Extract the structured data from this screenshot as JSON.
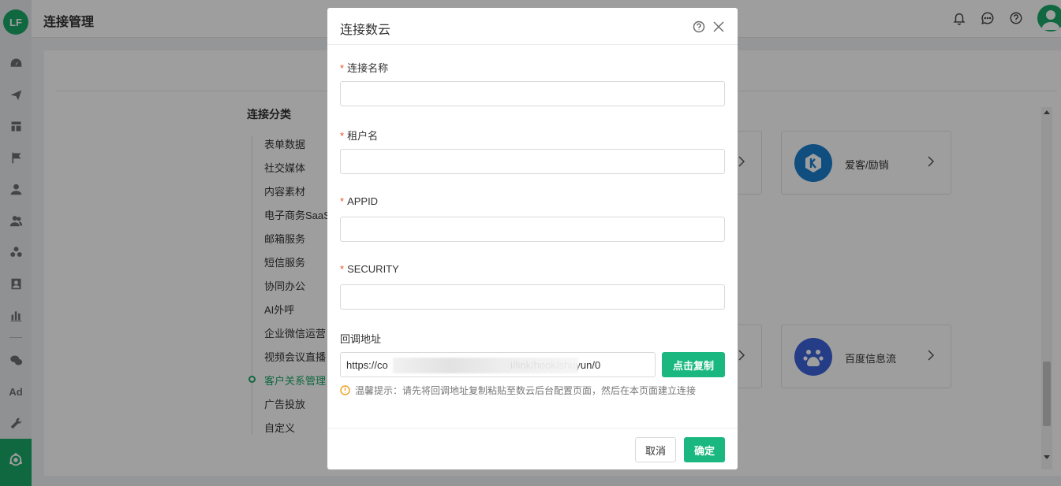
{
  "app": {
    "logo_text": "LF",
    "page_title": "连接管理"
  },
  "sidebar": {
    "items": [
      {
        "icon": "dashboard-icon"
      },
      {
        "icon": "send-icon"
      },
      {
        "icon": "layout-icon"
      },
      {
        "icon": "flag-icon"
      },
      {
        "icon": "user-icon"
      },
      {
        "icon": "users-icon"
      },
      {
        "icon": "groups-icon"
      },
      {
        "icon": "contact-card-icon"
      },
      {
        "icon": "bar-chart-icon"
      },
      {
        "icon": "wechat-icon"
      },
      {
        "icon": "ad-icon",
        "text": "Ad"
      },
      {
        "icon": "wrench-icon"
      },
      {
        "icon": "connection-icon",
        "active": true
      }
    ]
  },
  "header_icons": [
    "bell-icon",
    "message-icon",
    "help-icon",
    "avatar"
  ],
  "categories": {
    "title": "连接分类",
    "items": [
      {
        "label": "表单数据"
      },
      {
        "label": "社交媒体"
      },
      {
        "label": "内容素材"
      },
      {
        "label": "电子商务SaaS"
      },
      {
        "label": "邮箱服务"
      },
      {
        "label": "短信服务"
      },
      {
        "label": "协同办公"
      },
      {
        "label": "AI外呼"
      },
      {
        "label": "企业微信运营"
      },
      {
        "label": "视频会议直播"
      },
      {
        "label": "客户关系管理",
        "active": true
      },
      {
        "label": "广告投放"
      },
      {
        "label": "自定义"
      }
    ]
  },
  "connectors": [
    {
      "name": "爱客/励销",
      "color": "#1a7fcf"
    },
    {
      "name": "百度信息流",
      "color": "#3a63d8"
    }
  ],
  "modal": {
    "title": "连接数云",
    "fields": [
      {
        "label": "连接名称",
        "required": true,
        "value": ""
      },
      {
        "label": "租户名",
        "required": true,
        "value": ""
      },
      {
        "label": "APPID",
        "required": true,
        "value": ""
      },
      {
        "label": "SECURITY",
        "required": true,
        "value": ""
      }
    ],
    "callback": {
      "label": "回调地址",
      "url": "https://co                                           i/link/hook/shuyun/0",
      "copy_label": "点击复制"
    },
    "tip": "温馨提示：请先将回调地址复制粘贴至数云后台配置页面，然后在本页面建立连接",
    "cancel_label": "取消",
    "ok_label": "确定"
  },
  "colors": {
    "brand": "#1aa869",
    "primary_button": "#1ab880",
    "required": "#e8562a",
    "warning": "#f0a020"
  }
}
